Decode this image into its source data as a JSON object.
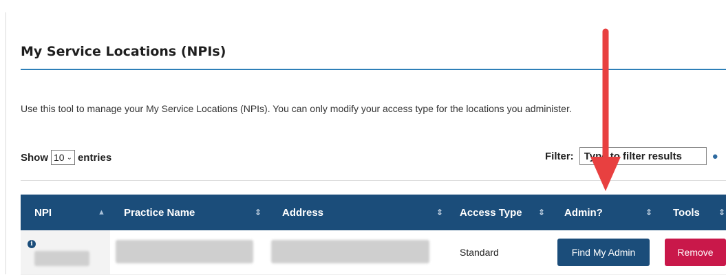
{
  "section": {
    "title": "My Service Locations (NPIs)",
    "description": "Use this tool to manage your My Service Locations (NPIs). You can only modify your access type for the locations you administer."
  },
  "controls": {
    "show_label": "Show",
    "entries_value": "10",
    "entries_label": "entries",
    "filter_label": "Filter:",
    "filter_placeholder": "Type to filter results"
  },
  "table": {
    "headers": [
      "NPI",
      "Practice Name",
      "Address",
      "Access Type",
      "Admin?",
      "Tools"
    ],
    "rows": [
      {
        "access_type": "Standard",
        "admin_button": "Find My Admin",
        "tools_button": "Remove"
      }
    ]
  },
  "colors": {
    "header_bg": "#1b4d7a",
    "accent_rule": "#2d7fb8",
    "remove_button": "#c9184a",
    "arrow": "#e84040"
  }
}
